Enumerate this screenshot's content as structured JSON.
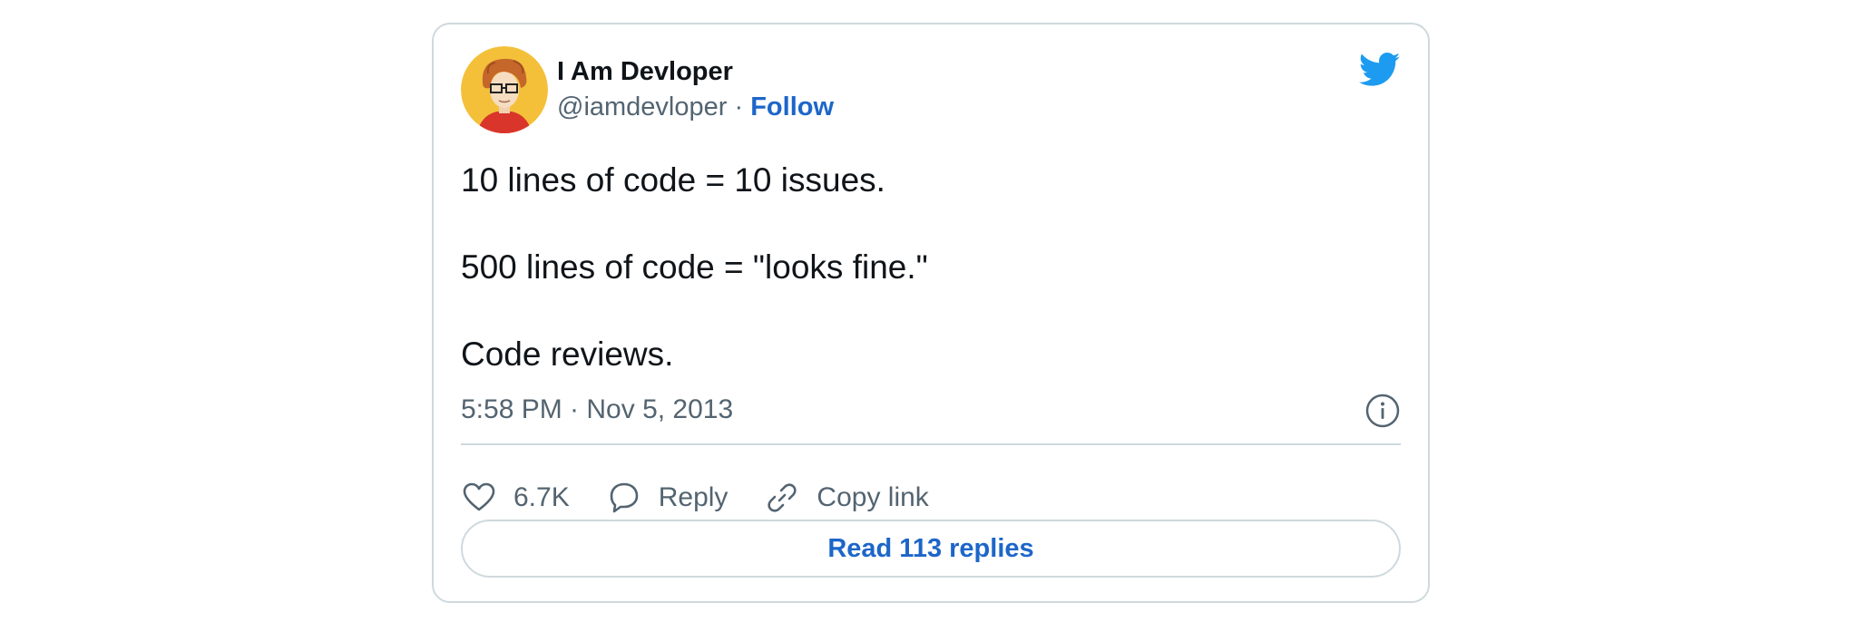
{
  "author": {
    "name": "I Am Devloper",
    "handle": "@iamdevloper",
    "separator": "·",
    "follow_label": "Follow"
  },
  "tweet": {
    "lines": [
      "10 lines of code = 10 issues.",
      "500 lines of code = \"looks fine.\"",
      "Code reviews."
    ],
    "timestamp": "5:58 PM · Nov 5, 2013"
  },
  "actions": {
    "likes": "6.7K",
    "reply_label": "Reply",
    "copy_link_label": "Copy link"
  },
  "read_replies_label": "Read 113 replies",
  "icons": {
    "brand": "twitter-bird-icon",
    "info": "info-icon",
    "like": "heart-icon",
    "reply": "speech-bubble-icon",
    "copy": "link-icon"
  },
  "colors": {
    "accent": "#1d66c9",
    "twitter_blue": "#1d9bf0",
    "secondary_text": "#536471",
    "primary_text": "#0f1419",
    "border": "#cfd9de",
    "avatar_bg": "#f4c03a"
  }
}
